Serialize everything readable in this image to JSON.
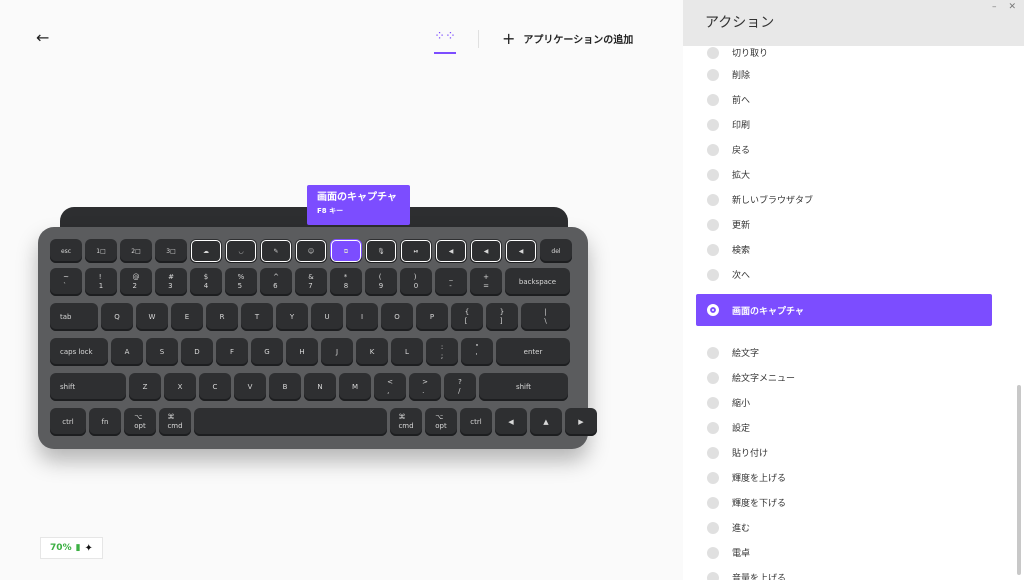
{
  "header": {
    "add_app_label": "アプリケーションの追加"
  },
  "tooltip": {
    "title": "画面のキャプチャ",
    "subtitle": "F8 キー"
  },
  "battery": {
    "percent": "70%"
  },
  "panel": {
    "title": "アクション"
  },
  "actions": [
    {
      "label": "切り取り"
    },
    {
      "label": "削除"
    },
    {
      "label": "前へ"
    },
    {
      "label": "印刷"
    },
    {
      "label": "戻る"
    },
    {
      "label": "拡大"
    },
    {
      "label": "新しいブラウザタブ"
    },
    {
      "label": "更新"
    },
    {
      "label": "検索"
    },
    {
      "label": "次へ"
    },
    {
      "label": "画面のキャプチャ"
    },
    {
      "label": "絵文字"
    },
    {
      "label": "絵文字メニュー"
    },
    {
      "label": "縮小"
    },
    {
      "label": "設定"
    },
    {
      "label": "貼り付け"
    },
    {
      "label": "輝度を上げる"
    },
    {
      "label": "輝度を下げる"
    },
    {
      "label": "進む"
    },
    {
      "label": "電卓"
    },
    {
      "label": "音量を上げる"
    }
  ],
  "keyboard": {
    "row0": [
      "esc",
      "1□",
      "2□",
      "3□",
      "☁",
      "◡",
      "✎",
      "☺",
      "⧉",
      "🎙",
      "⏯",
      "◀",
      "◀",
      "◀",
      "del"
    ],
    "row1": [
      "~\n`",
      "!\n1",
      "@\n2",
      "#\n3",
      "$\n4",
      "%\n5",
      "^\n6",
      "&\n7",
      "*\n8",
      "(\n9",
      ")\n0",
      "_\n-",
      "+\n=",
      "backspace"
    ],
    "row2": [
      "tab",
      "Q",
      "W",
      "E",
      "R",
      "T",
      "Y",
      "U",
      "I",
      "O",
      "P",
      "{\n[",
      "}\n]",
      "|\n\\"
    ],
    "row3": [
      "caps lock",
      "A",
      "S",
      "D",
      "F",
      "G",
      "H",
      "J",
      "K",
      "L",
      ":\n;",
      "\"\n'",
      "enter"
    ],
    "row4": [
      "shift",
      "Z",
      "X",
      "C",
      "V",
      "B",
      "N",
      "M",
      "<\n,",
      ">\n.",
      "?\n/",
      "shift"
    ],
    "row5": [
      "ctrl",
      "fn",
      "⌥\nopt",
      "⌘\ncmd",
      "",
      "⌘\ncmd",
      "⌥\nopt",
      "ctrl",
      "◀",
      "▲",
      "▶"
    ]
  }
}
